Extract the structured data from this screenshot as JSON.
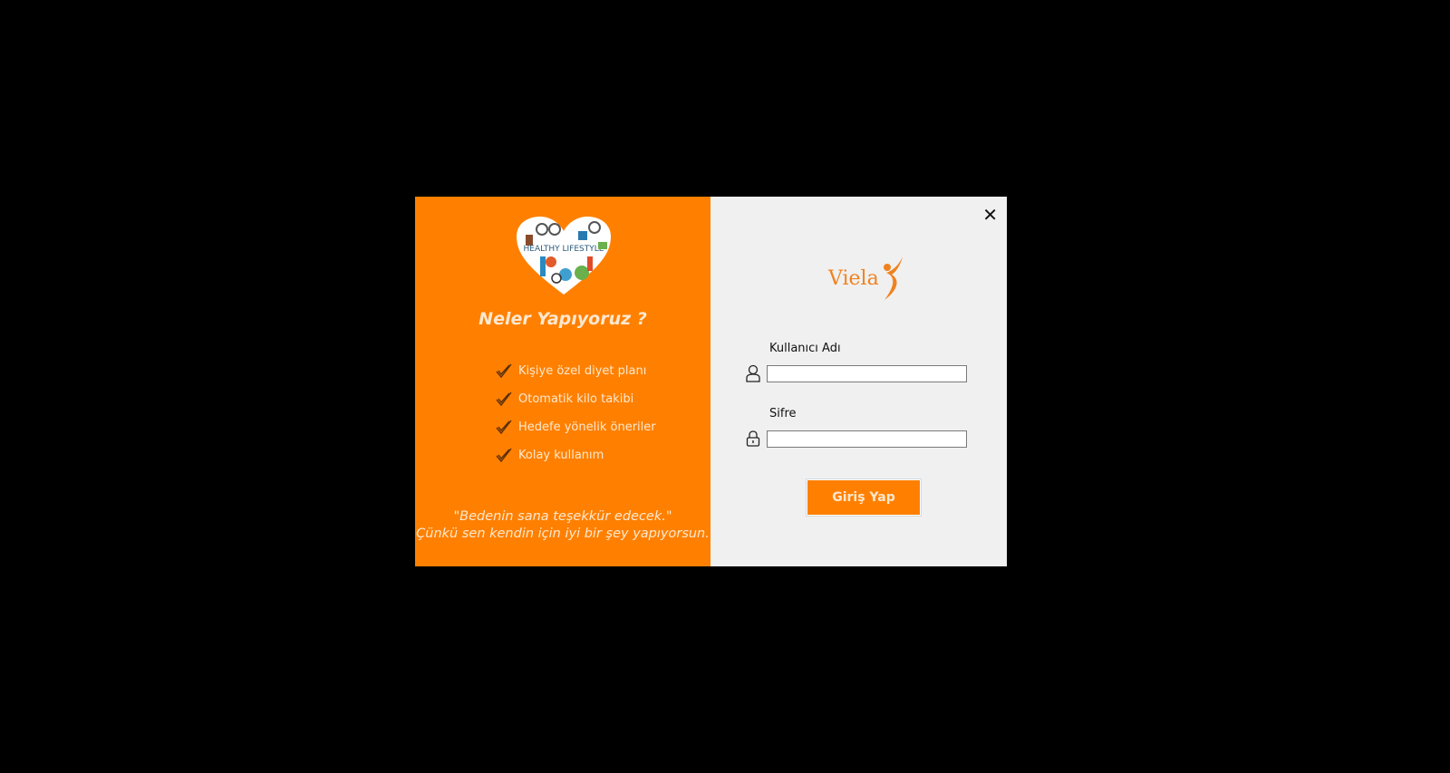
{
  "left": {
    "heart_logo_text": "HEALTHY LIFESTYLE",
    "title": "Neler Yapıyoruz ?",
    "features": [
      "Kişiye özel diyet planı",
      "Otomatik kilo takibi",
      "Hedefe yönelik öneriler",
      "Kolay kullanım"
    ],
    "quote_line1": "\"Bedenin sana teşekkür edecek.\"",
    "quote_line2": "Çünkü sen kendin için iyi bir şey yapıyorsun."
  },
  "right": {
    "close_label": "✕",
    "logo_text": "Viela",
    "username_label": "Kullanıcı Adı",
    "username_value": "",
    "password_label": "Sifre",
    "password_value": "",
    "login_button": "Giriş Yap"
  },
  "colors": {
    "accent": "#ff8000",
    "panel": "#f0f0f0"
  }
}
